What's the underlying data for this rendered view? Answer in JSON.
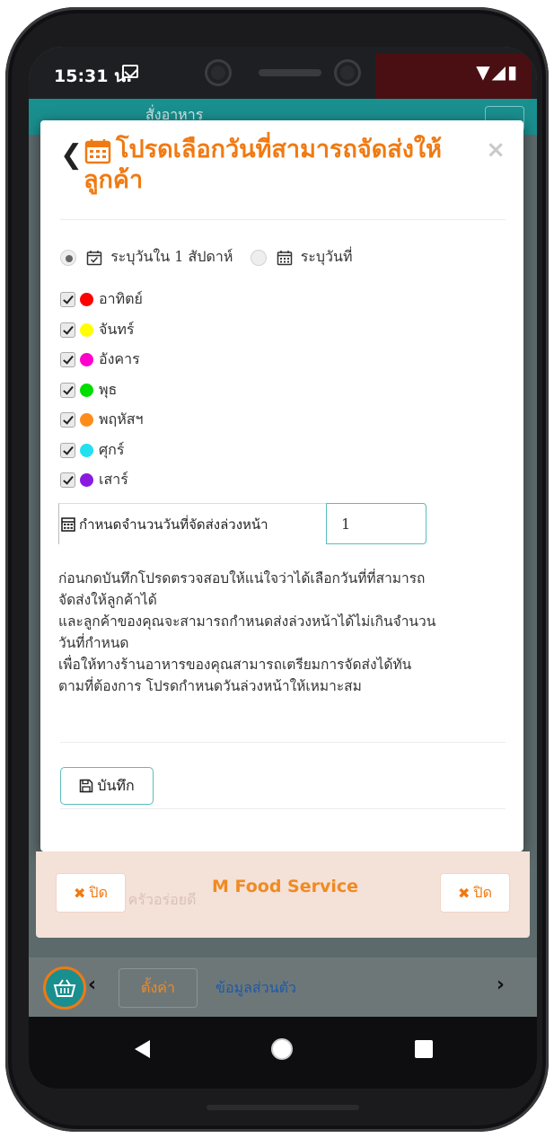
{
  "status_bar": {
    "time": "15:31 น.",
    "mail_icon": "gmail-icon",
    "right_icons": "▼◢▮"
  },
  "header": {
    "title": "สั่งอาหาร"
  },
  "modal": {
    "title": "โปรดเลือกวันที่สามารถจัดส่งให้ลูกค้า",
    "close_glyph": "×",
    "mode_options": [
      {
        "label": "ระบุวันใน 1 สัปดาห์",
        "selected": true
      },
      {
        "label": "ระบุวันที่",
        "selected": false
      }
    ],
    "days": [
      {
        "label": "อาทิตย์",
        "color": "#ff0000",
        "checked": true
      },
      {
        "label": "จันทร์",
        "color": "#ffff00",
        "checked": true
      },
      {
        "label": "อังคาร",
        "color": "#ff00cc",
        "checked": true
      },
      {
        "label": "พุธ",
        "color": "#00dd00",
        "checked": true
      },
      {
        "label": "พฤหัสฯ",
        "color": "#ff8c1a",
        "checked": true
      },
      {
        "label": "ศุกร์",
        "color": "#22e0f0",
        "checked": true
      },
      {
        "label": "เสาร์",
        "color": "#8a1ae0",
        "checked": true
      }
    ],
    "advance_days_label": "กำหนดจำนวนวันที่จัดส่งล่วงหน้า",
    "advance_days_value": "1",
    "notice_lines": [
      "ก่อนกดบันทึกโปรดตรวจสอบให้แน่ใจว่าได้เลือกวันที่ที่สามารถ",
      "จัดส่งให้ลูกค้าได้",
      "และลูกค้าของคุณจะสามารถกำหนดส่งล่วงหน้าได้ไม่เกินจำนวน",
      "วันที่กำหนด",
      "เพื่อให้ทางร้านอาหารของคุณสามารถเตรียมการจัดส่งได้ทัน",
      "ตามที่ต้องการ โปรดกำหนดวันล่วงหน้าให้เหมาะสม"
    ],
    "save_label": "บันทึก"
  },
  "bottom_panel": {
    "title": "M Food Service",
    "ghost_text": "สั่ง ครัวอร่อยดี",
    "close_left": "ปิด",
    "close_right": "ปิด"
  },
  "bottom_nav": {
    "prev_glyph": "‹",
    "next_glyph": "›",
    "tab_settings": "ตั้งค่า",
    "tab_profile": "ข้อมูลส่วนตัว"
  },
  "colors": {
    "accent_orange": "#f07a12",
    "teal": "#1a8f8f",
    "input_border": "#5bbcbc"
  }
}
